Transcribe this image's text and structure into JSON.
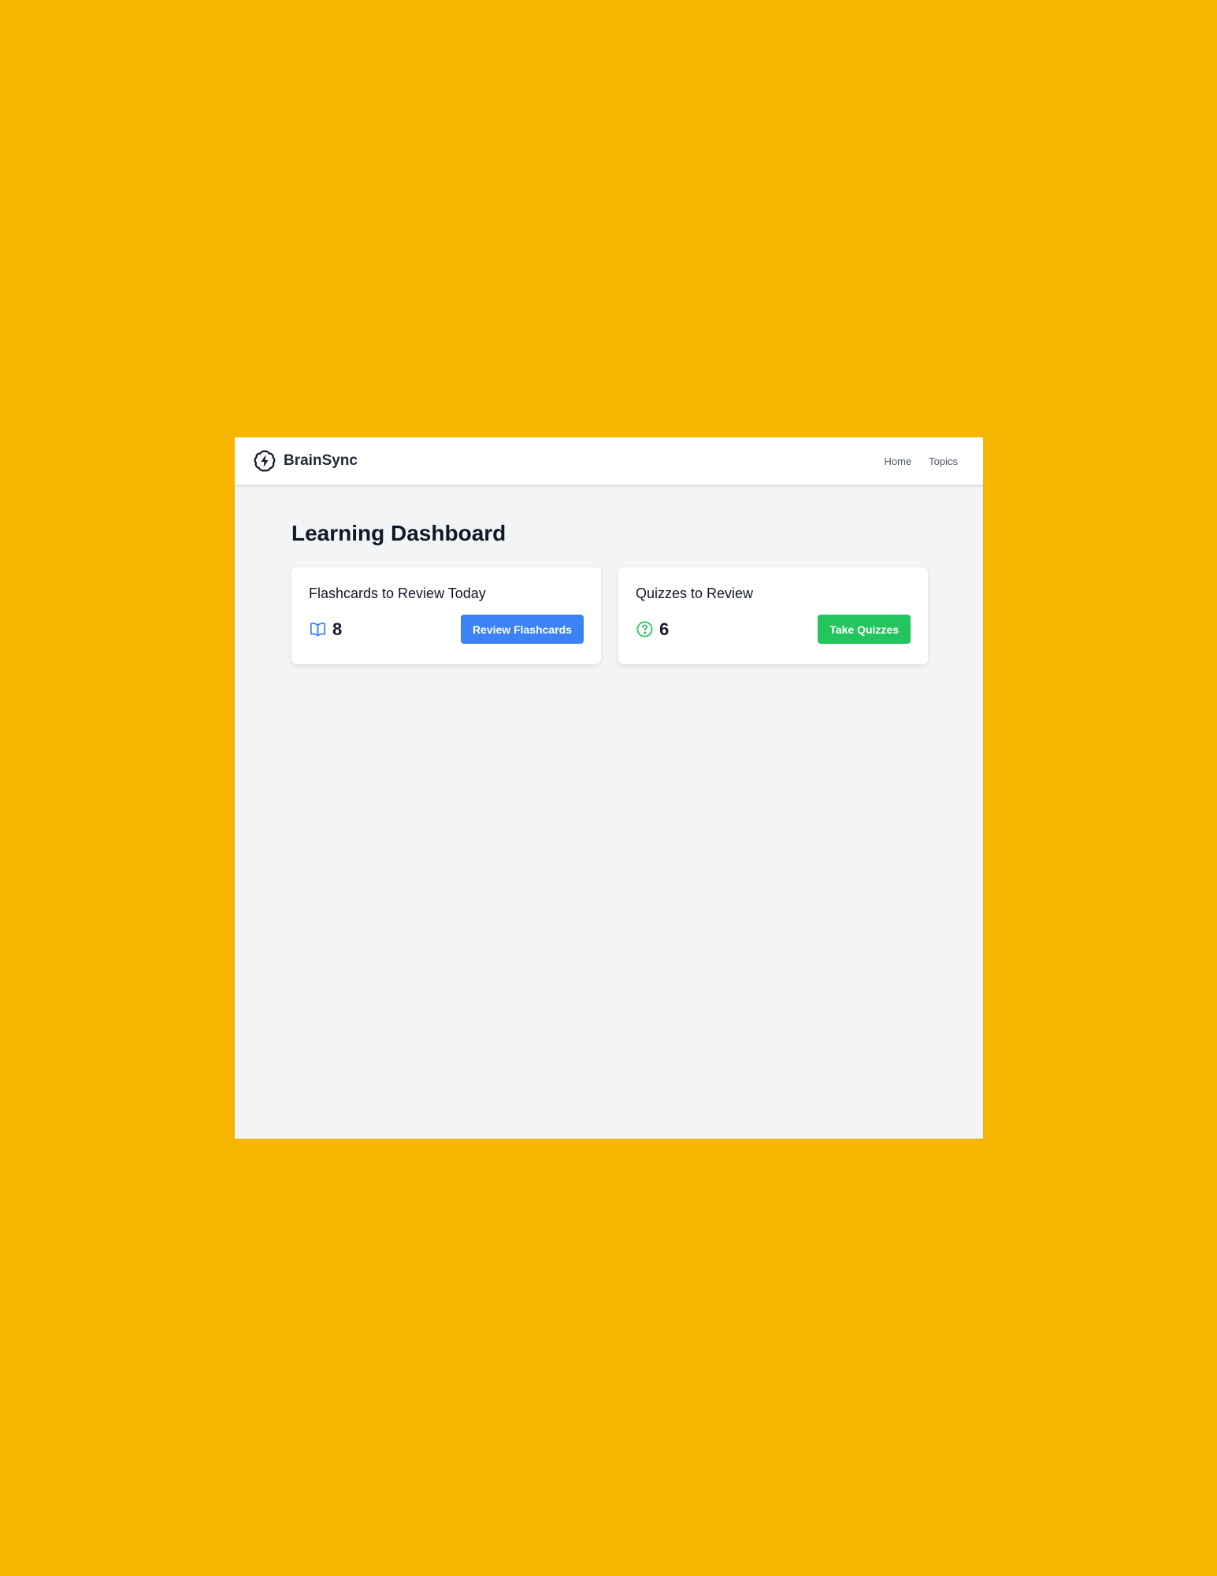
{
  "app": {
    "brand_name": "BrainSync",
    "brand_icon": "brain-lightning-icon"
  },
  "nav": {
    "items": [
      {
        "label": "Home"
      },
      {
        "label": "Topics"
      }
    ]
  },
  "main": {
    "title": "Learning Dashboard",
    "cards": [
      {
        "title": "Flashcards to Review Today",
        "icon": "book-open-icon",
        "icon_color": "#3B82F6",
        "value": "8",
        "button_label": "Review Flashcards",
        "button_color": "#3B82F6"
      },
      {
        "title": "Quizzes to Review",
        "icon": "question-circle-icon",
        "icon_color": "#22C55E",
        "value": "6",
        "button_label": "Take Quizzes",
        "button_color": "#22C55E"
      }
    ]
  },
  "colors": {
    "page_background": "#F8B500",
    "app_background": "#F3F4F6",
    "card_background": "#FFFFFF"
  }
}
